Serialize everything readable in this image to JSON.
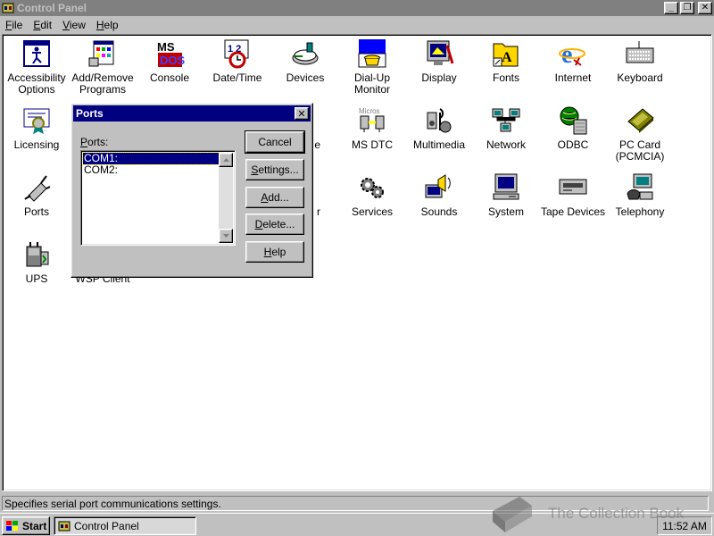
{
  "window": {
    "title": "Control Panel"
  },
  "menu": [
    {
      "underline": "F",
      "rest": "ile"
    },
    {
      "underline": "E",
      "rest": "dit"
    },
    {
      "underline": "V",
      "rest": "iew"
    },
    {
      "underline": "H",
      "rest": "elp"
    }
  ],
  "items": [
    {
      "label": "Accessibility\nOptions",
      "icon": "accessibility-icon"
    },
    {
      "label": "Add/Remove\nPrograms",
      "icon": "add-remove-programs-icon"
    },
    {
      "label": "Console",
      "icon": "console-icon"
    },
    {
      "label": "Date/Time",
      "icon": "date-time-icon"
    },
    {
      "label": "Devices",
      "icon": "devices-icon"
    },
    {
      "label": "Dial-Up\nMonitor",
      "icon": "dial-up-monitor-icon"
    },
    {
      "label": "Display",
      "icon": "display-icon"
    },
    {
      "label": "Fonts",
      "icon": "fonts-icon"
    },
    {
      "label": "Internet",
      "icon": "internet-icon"
    },
    {
      "label": "Keyboard",
      "icon": "keyboard-icon"
    },
    {
      "label": "Licensing",
      "icon": "licensing-icon"
    },
    {
      "label": "e",
      "icon": ""
    },
    {
      "label": "MS DTC",
      "icon": "ms-dtc-icon"
    },
    {
      "label": "Multimedia",
      "icon": "multimedia-icon"
    },
    {
      "label": "Network",
      "icon": "network-icon"
    },
    {
      "label": "ODBC",
      "icon": "odbc-icon"
    },
    {
      "label": "PC Card\n(PCMCIA)",
      "icon": "pc-card-icon"
    },
    {
      "label": "Ports",
      "icon": "ports-icon"
    },
    {
      "label": "r",
      "icon": ""
    },
    {
      "label": "Services",
      "icon": "services-icon"
    },
    {
      "label": "Sounds",
      "icon": "sounds-icon"
    },
    {
      "label": "System",
      "icon": "system-icon"
    },
    {
      "label": "Tape Devices",
      "icon": "tape-devices-icon"
    },
    {
      "label": "Telephony",
      "icon": "telephony-icon"
    },
    {
      "label": "UPS",
      "icon": "ups-icon"
    },
    {
      "label": "WSP Client",
      "icon": ""
    }
  ],
  "status": {
    "text": "Specifies serial port communications settings."
  },
  "taskbar": {
    "start_label": "Start",
    "task_label": "Control Panel",
    "clock": "11:52 AM"
  },
  "watermark": {
    "text": "The Collection Book"
  },
  "dialog": {
    "title": "Ports",
    "list_label_underline": "P",
    "list_label_rest": "orts:",
    "ports": [
      "COM1:",
      "COM2:"
    ],
    "selected_index": 0,
    "buttons": [
      {
        "underline": "",
        "rest": "Cancel"
      },
      {
        "underline": "S",
        "rest": "ettings..."
      },
      {
        "underline": "A",
        "rest": "dd..."
      },
      {
        "underline": "D",
        "rest": "elete..."
      },
      {
        "underline": "H",
        "rest": "elp"
      }
    ]
  },
  "colors": {
    "dialog_title": "#000080",
    "inactive_title": "#808080",
    "selection": "#000080",
    "face": "#c0c0c0"
  }
}
